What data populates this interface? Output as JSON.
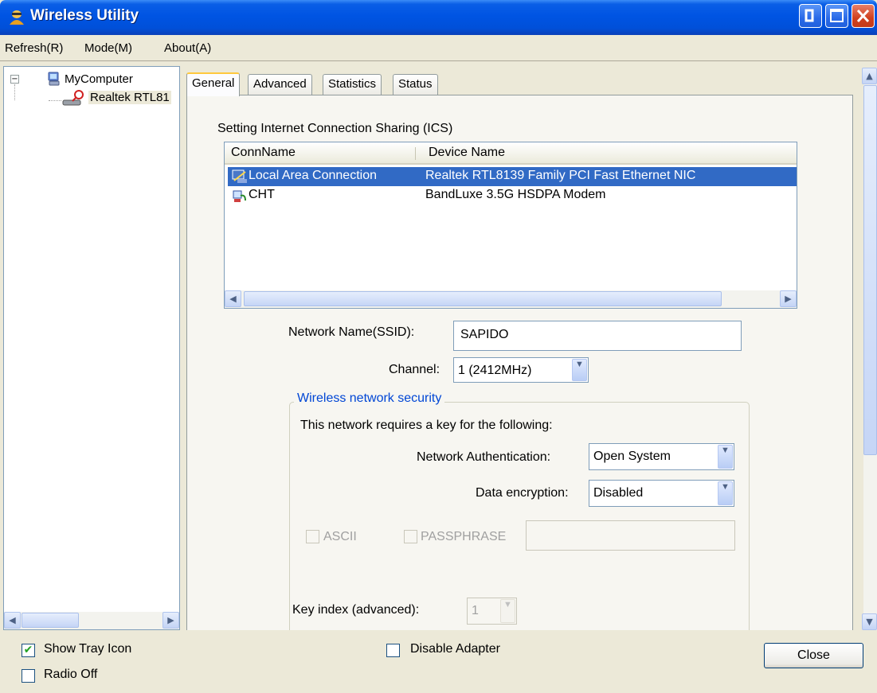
{
  "window": {
    "title": "Wireless Utility"
  },
  "menu": [
    "Refresh(R)",
    "Mode(M)",
    "About(A)"
  ],
  "tree": {
    "root": "MyComputer",
    "child": "Realtek RTL81"
  },
  "tabs": [
    "General",
    "Advanced",
    "Statistics",
    "Status"
  ],
  "general": {
    "ics_label": "Setting Internet Connection Sharing (ICS)",
    "ics_columns": [
      "ConnName",
      "Device Name"
    ],
    "ics_rows": [
      {
        "conn": "Local Area Connection",
        "device": "Realtek RTL8139 Family PCI Fast Ethernet NIC",
        "selected": true
      },
      {
        "conn": "CHT",
        "device": "BandLuxe 3.5G HSDPA Modem",
        "selected": false
      }
    ],
    "ssid_label": "Network Name(SSID):",
    "ssid_value": "SAPIDO",
    "channel_label": "Channel:",
    "channel_value": "1  (2412MHz)",
    "security": {
      "legend": "Wireless network security",
      "intro": "This network requires a key for the following:",
      "auth_label": "Network Authentication:",
      "auth_value": "Open System",
      "enc_label": "Data encryption:",
      "enc_value": "Disabled",
      "ascii_label": "ASCII",
      "passphrase_label": "PASSPHRASE",
      "keyindex_label": "Key index (advanced):",
      "keyindex_value": "1"
    }
  },
  "footer": {
    "show_tray_label": "Show Tray Icon",
    "show_tray_checked": true,
    "radio_off_label": "Radio Off",
    "radio_off_checked": false,
    "disable_adapter_label": "Disable Adapter",
    "disable_adapter_checked": false,
    "close_label": "Close"
  },
  "colors": {
    "titlebar": "#0054e3",
    "selection": "#316ac5",
    "group_legend": "#0046d5",
    "dialog_bg": "#ece9d8"
  },
  "icons": {
    "app": "wireless-user-icon",
    "computer": "computer-icon",
    "adapter": "wireless-adapter-icon",
    "lan": "network-connection-icon",
    "modem": "dialup-connection-icon"
  }
}
